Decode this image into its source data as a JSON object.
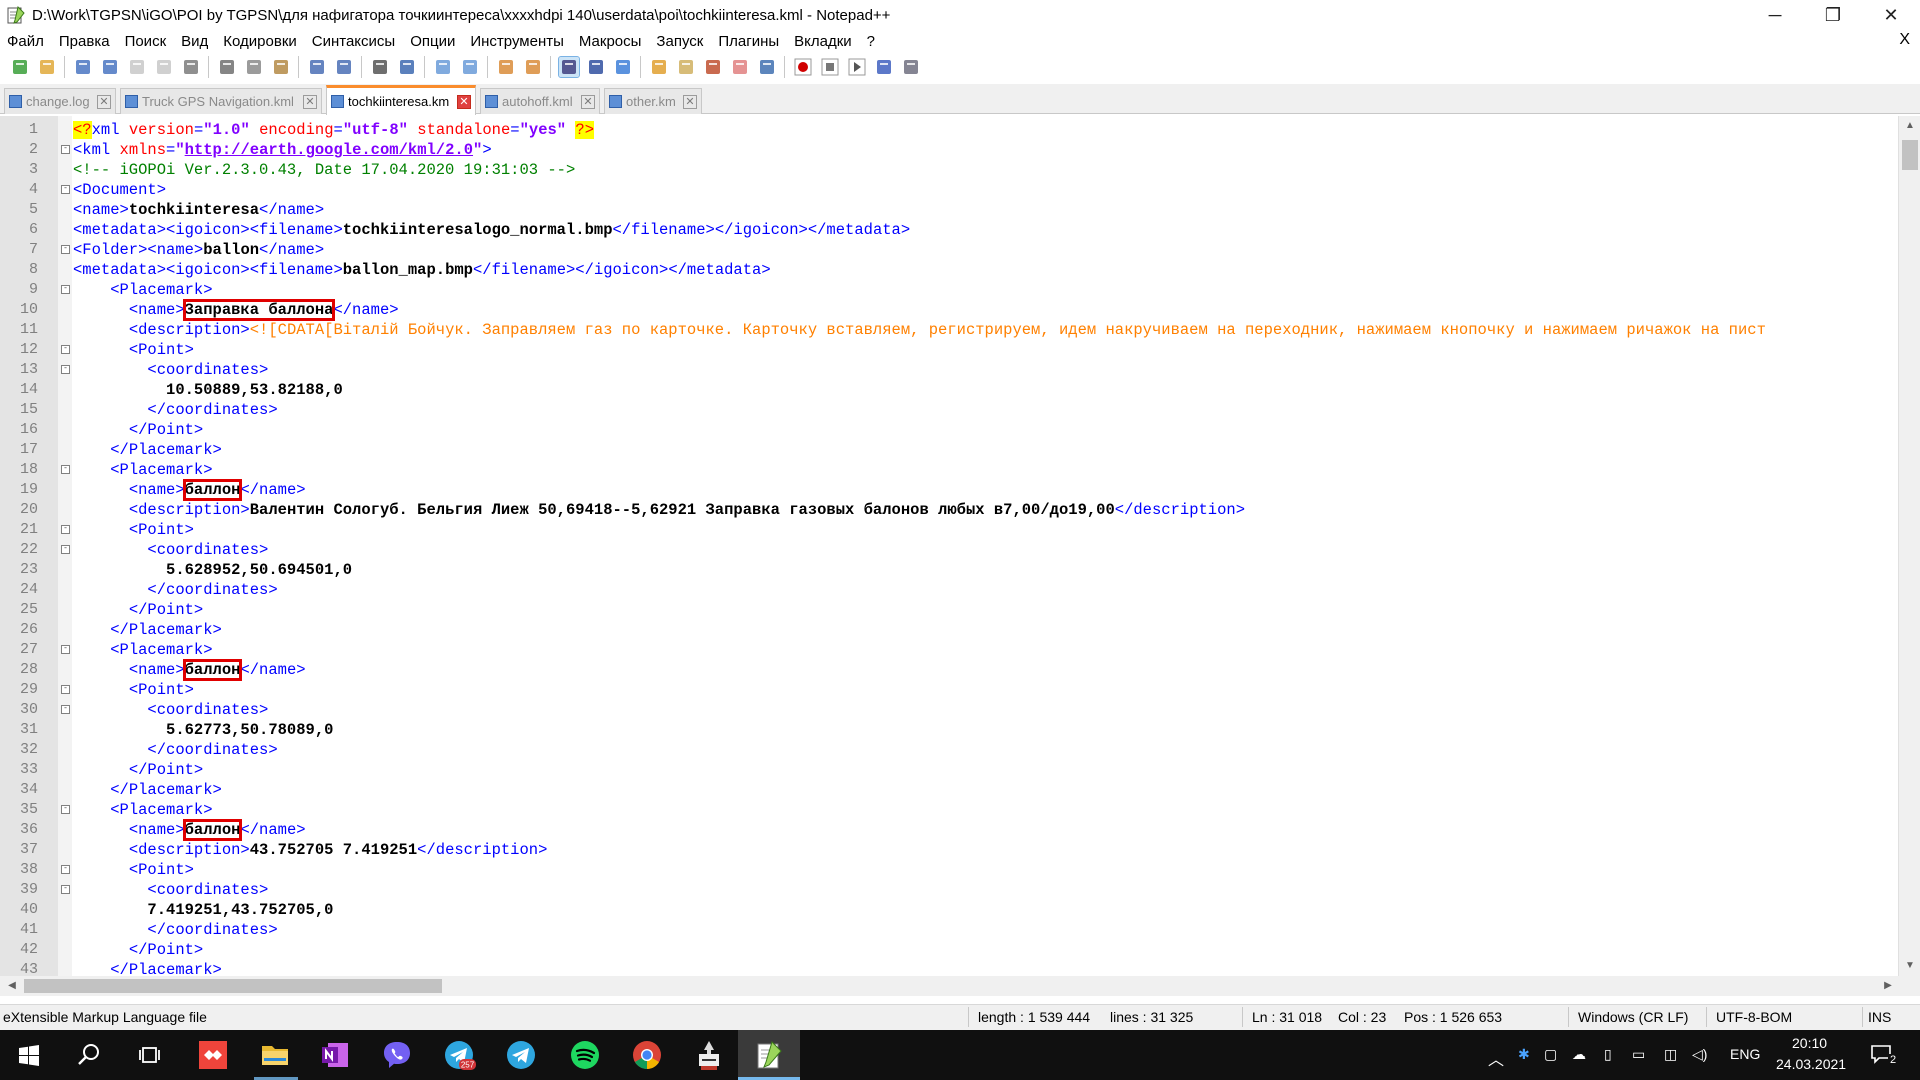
{
  "window": {
    "title": "D:\\Work\\TGPSN\\iGO\\POI by TGPSN\\для нафигатора точкиинтереса\\xxxxhdpi 140\\userdata\\poi\\tochkiinteresa.kml - Notepad++",
    "min": "─",
    "restore": "❐",
    "close": "✕"
  },
  "menu": {
    "items": [
      "Файл",
      "Правка",
      "Поиск",
      "Вид",
      "Кодировки",
      "Синтаксисы",
      "Опции",
      "Инструменты",
      "Макросы",
      "Запуск",
      "Плагины",
      "Вкладки",
      "?"
    ],
    "close": "X"
  },
  "toolbar": {
    "icons": [
      "new-file-icon",
      "open-file-icon",
      "save-icon",
      "save-all-icon",
      "close-icon",
      "close-all-icon",
      "print-icon",
      "cut-icon",
      "copy-icon",
      "paste-icon",
      "undo-icon",
      "redo-icon",
      "find-icon",
      "replace-icon",
      "zoom-in-icon",
      "zoom-out-icon",
      "sync-v-icon",
      "sync-h-icon",
      "word-wrap-icon",
      "show-all-chars-icon",
      "indent-guide-icon",
      "udl-icon",
      "doc-map-icon",
      "function-list-icon",
      "folder-workspace-icon",
      "monitor-icon",
      "record-macro-icon",
      "stop-macro-icon",
      "play-macro-icon",
      "run-macro-multiple-icon",
      "save-macro-icon"
    ]
  },
  "tabs": [
    {
      "label": "change.log",
      "active": false
    },
    {
      "label": "Truck GPS Navigation.kml",
      "active": false
    },
    {
      "label": "tochkiinteresa.kml",
      "active": true
    },
    {
      "label": "autohoff.kml",
      "active": false
    },
    {
      "label": "other.kml",
      "active": false
    }
  ],
  "editor": {
    "lines": [
      {
        "n": "1",
        "fold": "",
        "indent": "",
        "parts": [
          [
            "pi",
            "<?"
          ],
          [
            "tag",
            "xml "
          ],
          [
            "attr",
            "version"
          ],
          [
            "tag",
            "="
          ],
          [
            "val",
            "\"1.0\""
          ],
          [
            "tag",
            " "
          ],
          [
            "attr",
            "encoding"
          ],
          [
            "tag",
            "="
          ],
          [
            "val",
            "\"utf-8\""
          ],
          [
            "tag",
            " "
          ],
          [
            "attr",
            "standalone"
          ],
          [
            "tag",
            "="
          ],
          [
            "val",
            "\"yes\""
          ],
          [
            "tag",
            " "
          ],
          [
            "pi",
            "?>"
          ]
        ]
      },
      {
        "n": "2",
        "fold": "-",
        "indent": "",
        "parts": [
          [
            "tag",
            "<kml "
          ],
          [
            "attr",
            "xmlns"
          ],
          [
            "tag",
            "="
          ],
          [
            "val",
            "\""
          ],
          [
            "url",
            "http://earth.google.com/kml/2.0"
          ],
          [
            "val",
            "\""
          ],
          [
            "tag",
            ">"
          ]
        ]
      },
      {
        "n": "3",
        "fold": "",
        "indent": "",
        "parts": [
          [
            "cmt",
            "<!-- iGOPOi Ver.2.3.0.43, Date 17.04.2020 19:31:03 -->"
          ]
        ]
      },
      {
        "n": "4",
        "fold": "-",
        "indent": "",
        "parts": [
          [
            "tag",
            "<Document>"
          ]
        ]
      },
      {
        "n": "5",
        "fold": "",
        "indent": "",
        "parts": [
          [
            "tag",
            "<name>"
          ],
          [
            "txt",
            "tochkiinteresa"
          ],
          [
            "tag",
            "</name>"
          ]
        ]
      },
      {
        "n": "6",
        "fold": "",
        "indent": "",
        "parts": [
          [
            "tag",
            "<metadata><igoicon><filename>"
          ],
          [
            "txt",
            "tochkiinteresalogo_normal.bmp"
          ],
          [
            "tag",
            "</filename></igoicon></metadata>"
          ]
        ]
      },
      {
        "n": "7",
        "fold": "-",
        "indent": "",
        "parts": [
          [
            "tag",
            "<Folder><name>"
          ],
          [
            "txt",
            "ballon"
          ],
          [
            "tag",
            "</name>"
          ]
        ]
      },
      {
        "n": "8",
        "fold": "",
        "indent": "",
        "parts": [
          [
            "tag",
            "<metadata><igoicon><filename>"
          ],
          [
            "txt",
            "ballon_map.bmp"
          ],
          [
            "tag",
            "</filename></igoicon></metadata>"
          ]
        ]
      },
      {
        "n": "9",
        "fold": "-",
        "indent": "    ",
        "parts": [
          [
            "tag",
            "<Placemark>"
          ]
        ]
      },
      {
        "n": "10",
        "fold": "",
        "indent": "      ",
        "parts": [
          [
            "tag",
            "<name>"
          ],
          [
            "hl",
            "Заправка баллона"
          ],
          [
            "tag",
            "</name>"
          ]
        ]
      },
      {
        "n": "11",
        "fold": "",
        "indent": "      ",
        "parts": [
          [
            "tag",
            "<description>"
          ],
          [
            "cdata",
            "<![CDATA[Віталій Бойчук. Заправляем газ по карточке. Карточку вставляем, регистрируем, идем накручиваем на переходник, нажимаем кнопочку и нажимаем ричажок на пист"
          ]
        ]
      },
      {
        "n": "12",
        "fold": "-",
        "indent": "      ",
        "parts": [
          [
            "tag",
            "<Point>"
          ]
        ]
      },
      {
        "n": "13",
        "fold": "-",
        "indent": "        ",
        "parts": [
          [
            "tag",
            "<coordinates>"
          ]
        ]
      },
      {
        "n": "14",
        "fold": "",
        "indent": "          ",
        "parts": [
          [
            "txt",
            "10.50889,53.82188,0"
          ]
        ]
      },
      {
        "n": "15",
        "fold": "",
        "indent": "        ",
        "parts": [
          [
            "tag",
            "</coordinates>"
          ]
        ]
      },
      {
        "n": "16",
        "fold": "",
        "indent": "      ",
        "parts": [
          [
            "tag",
            "</Point>"
          ]
        ]
      },
      {
        "n": "17",
        "fold": "",
        "indent": "    ",
        "parts": [
          [
            "tag",
            "</Placemark>"
          ]
        ]
      },
      {
        "n": "18",
        "fold": "-",
        "indent": "    ",
        "parts": [
          [
            "tag",
            "<Placemark>"
          ]
        ]
      },
      {
        "n": "19",
        "fold": "",
        "indent": "      ",
        "parts": [
          [
            "tag",
            "<name>"
          ],
          [
            "hl",
            "баллон"
          ],
          [
            "tag",
            "</name>"
          ]
        ]
      },
      {
        "n": "20",
        "fold": "",
        "indent": "      ",
        "parts": [
          [
            "tag",
            "<description>"
          ],
          [
            "txt",
            "Валентин Сологуб. Бельгия Лиеж 50,69418--5,62921 Заправка газовых балонов любых в7,00/до19,00"
          ],
          [
            "tag",
            "</description>"
          ]
        ]
      },
      {
        "n": "21",
        "fold": "-",
        "indent": "      ",
        "parts": [
          [
            "tag",
            "<Point>"
          ]
        ]
      },
      {
        "n": "22",
        "fold": "-",
        "indent": "        ",
        "parts": [
          [
            "tag",
            "<coordinates>"
          ]
        ]
      },
      {
        "n": "23",
        "fold": "",
        "indent": "          ",
        "parts": [
          [
            "txt",
            "5.628952,50.694501,0"
          ]
        ]
      },
      {
        "n": "24",
        "fold": "",
        "indent": "        ",
        "parts": [
          [
            "tag",
            "</coordinates>"
          ]
        ]
      },
      {
        "n": "25",
        "fold": "",
        "indent": "      ",
        "parts": [
          [
            "tag",
            "</Point>"
          ]
        ]
      },
      {
        "n": "26",
        "fold": "",
        "indent": "    ",
        "parts": [
          [
            "tag",
            "</Placemark>"
          ]
        ]
      },
      {
        "n": "27",
        "fold": "-",
        "indent": "    ",
        "parts": [
          [
            "tag",
            "<Placemark>"
          ]
        ]
      },
      {
        "n": "28",
        "fold": "",
        "indent": "      ",
        "parts": [
          [
            "tag",
            "<name>"
          ],
          [
            "hl",
            "баллон"
          ],
          [
            "tag",
            "</name>"
          ]
        ]
      },
      {
        "n": "29",
        "fold": "-",
        "indent": "      ",
        "parts": [
          [
            "tag",
            "<Point>"
          ]
        ]
      },
      {
        "n": "30",
        "fold": "-",
        "indent": "        ",
        "parts": [
          [
            "tag",
            "<coordinates>"
          ]
        ]
      },
      {
        "n": "31",
        "fold": "",
        "indent": "          ",
        "parts": [
          [
            "txt",
            "5.62773,50.78089,0"
          ]
        ]
      },
      {
        "n": "32",
        "fold": "",
        "indent": "        ",
        "parts": [
          [
            "tag",
            "</coordinates>"
          ]
        ]
      },
      {
        "n": "33",
        "fold": "",
        "indent": "      ",
        "parts": [
          [
            "tag",
            "</Point>"
          ]
        ]
      },
      {
        "n": "34",
        "fold": "",
        "indent": "    ",
        "parts": [
          [
            "tag",
            "</Placemark>"
          ]
        ]
      },
      {
        "n": "35",
        "fold": "-",
        "indent": "    ",
        "parts": [
          [
            "tag",
            "<Placemark>"
          ]
        ]
      },
      {
        "n": "36",
        "fold": "",
        "indent": "      ",
        "parts": [
          [
            "tag",
            "<name>"
          ],
          [
            "hl",
            "баллон"
          ],
          [
            "tag",
            "</name>"
          ]
        ]
      },
      {
        "n": "37",
        "fold": "",
        "indent": "      ",
        "parts": [
          [
            "tag",
            "<description>"
          ],
          [
            "txt",
            "43.752705 7.419251"
          ],
          [
            "tag",
            "</description>"
          ]
        ]
      },
      {
        "n": "38",
        "fold": "-",
        "indent": "      ",
        "parts": [
          [
            "tag",
            "<Point>"
          ]
        ]
      },
      {
        "n": "39",
        "fold": "-",
        "indent": "        ",
        "parts": [
          [
            "tag",
            "<coordinates>"
          ]
        ]
      },
      {
        "n": "40",
        "fold": "",
        "indent": "        ",
        "parts": [
          [
            "txt",
            "7.419251,43.752705,0"
          ]
        ]
      },
      {
        "n": "41",
        "fold": "",
        "indent": "        ",
        "parts": [
          [
            "tag",
            "</coordinates>"
          ]
        ]
      },
      {
        "n": "42",
        "fold": "",
        "indent": "      ",
        "parts": [
          [
            "tag",
            "</Point>"
          ]
        ]
      },
      {
        "n": "43",
        "fold": "",
        "indent": "    ",
        "parts": [
          [
            "tag",
            "</Placemark>"
          ]
        ]
      }
    ]
  },
  "status": {
    "filetype": "eXtensible Markup Language file",
    "length": "length : 1 539 444",
    "lines": "lines : 31 325",
    "ln": "Ln : 31 018",
    "col": "Col : 23",
    "pos": "Pos : 1 526 653",
    "eol": "Windows (CR LF)",
    "encoding": "UTF-8-BOM",
    "mode": "INS"
  },
  "taskbar": {
    "apps": [
      "start-icon",
      "search-icon",
      "task-view-icon",
      "anydesk-icon",
      "file-explorer-icon",
      "onenote-icon",
      "viber-icon",
      "telegram-icon",
      "telegram-desktop-icon",
      "spotify-icon",
      "chrome-icon",
      "igo-tool-icon",
      "notepadpp-icon"
    ],
    "telegram_badge": "257",
    "lang": "ENG",
    "time": "20:10",
    "date": "24.03.2021",
    "notifications": "2"
  },
  "colors": {
    "tag": "#0000ff",
    "attr": "#ff0000",
    "value": "#8000ff",
    "comment": "#008000",
    "cdata": "#ff8000",
    "highlight_box": "#e00000",
    "active_tab_accent": "#fa8c2c"
  }
}
